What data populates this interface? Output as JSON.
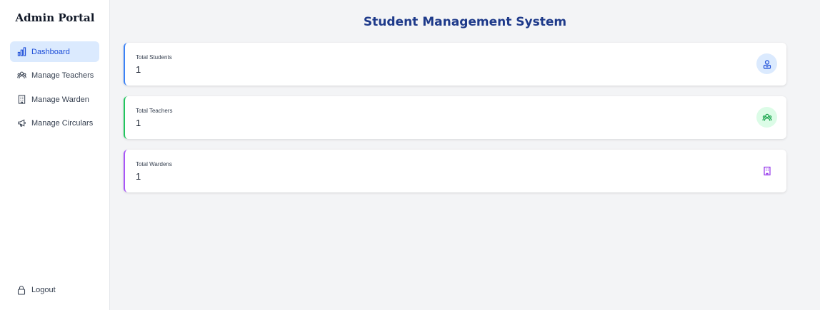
{
  "sidebar": {
    "brand": "Admin Portal",
    "items": [
      {
        "label": "Dashboard",
        "icon": "bar-chart-icon",
        "active": true
      },
      {
        "label": "Manage Teachers",
        "icon": "users-icon",
        "active": false
      },
      {
        "label": "Manage Warden",
        "icon": "building-icon",
        "active": false
      },
      {
        "label": "Manage Circulars",
        "icon": "megaphone-icon",
        "active": false
      }
    ],
    "logout": {
      "label": "Logout",
      "icon": "lock-icon"
    }
  },
  "header": {
    "title": "Student Management System"
  },
  "stats": [
    {
      "label": "Total Students",
      "value": "1",
      "accent": "#3b82f6",
      "icon": "student-icon",
      "icon_bg": "#dbeafe",
      "icon_color": "#1d4ed8"
    },
    {
      "label": "Total Teachers",
      "value": "1",
      "accent": "#22c55e",
      "icon": "users-icon",
      "icon_bg": "#dcfce7",
      "icon_color": "#16a34a"
    },
    {
      "label": "Total Wardens",
      "value": "1",
      "accent": "#a855f7",
      "icon": "building-icon",
      "icon_bg": "#ffffff",
      "icon_color": "#9333ea"
    }
  ]
}
